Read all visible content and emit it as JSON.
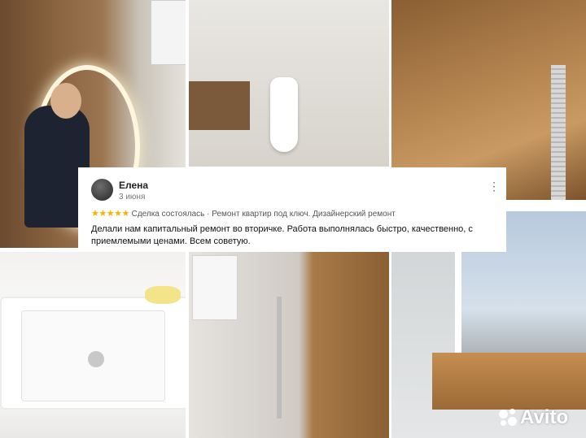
{
  "review": {
    "author_name": "Елена",
    "date": "3 июня",
    "rating_stars": "★★★★★",
    "rating_value": 5,
    "meta": "Сделка состоялась · Ремонт квартир под ключ. Дизайнерский ремонт",
    "text": "Делали нам капитальный ремонт во вторичке. Работа выполнялась быстро, качественно, с приемлемыми ценами. Всем советую."
  },
  "more_icon": "more-vertical-icon",
  "watermark": {
    "label": "Avito",
    "icon": "avito-logo-icon"
  },
  "colors": {
    "stars": "#f4b400",
    "card_bg": "#ffffff",
    "text": "#111111"
  }
}
